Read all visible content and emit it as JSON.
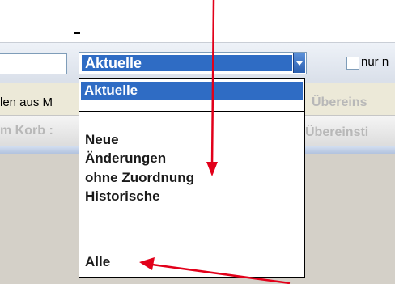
{
  "filter_select": {
    "selected_value": "Aktuelle",
    "options_top": [
      "Aktuelle"
    ],
    "options_middle": [
      "Neue",
      "Änderungen",
      "ohne Zuordnung",
      "Historische"
    ],
    "options_bottom": [
      "Alle"
    ]
  },
  "checkbox_label": "nur n",
  "row2_label": "len aus M",
  "row3_label": "m Korb :",
  "uebereins_button_1": "Übereins",
  "uebereins_button_2": "Übereinsti",
  "colors": {
    "selection": "#2f6cc4",
    "arrow": "#e2001a"
  }
}
